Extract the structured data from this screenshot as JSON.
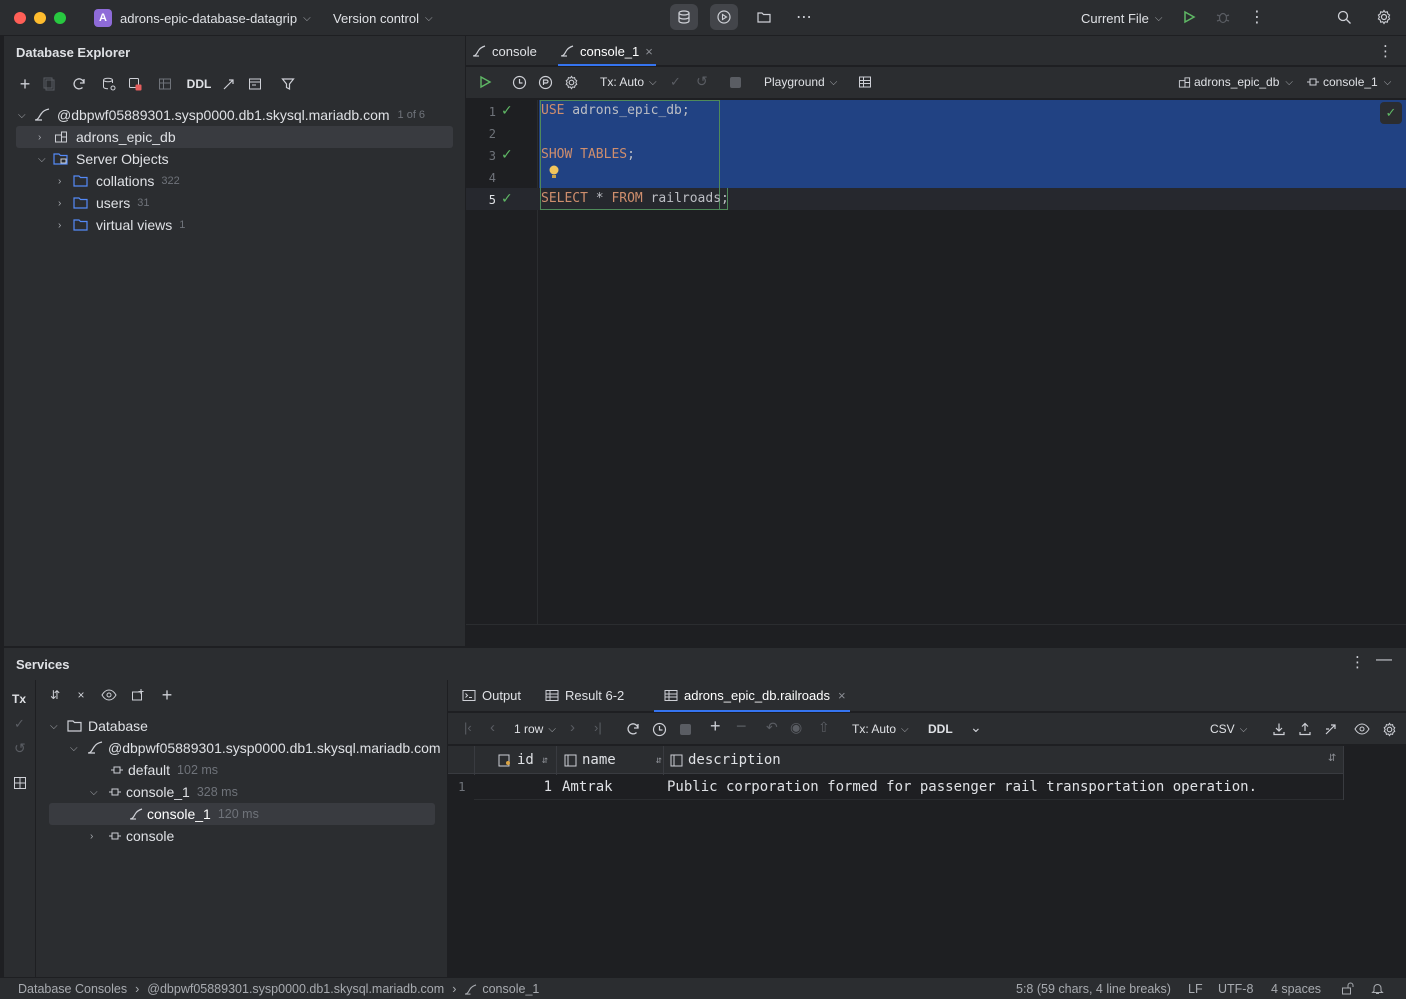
{
  "window": {
    "project_initial": "A",
    "project_name": "adrons-epic-database-datagrip",
    "version_control": "Version control",
    "run_config": "Current File"
  },
  "db_explorer": {
    "title": "Database Explorer",
    "ddl_label": "DDL",
    "tree": {
      "connection": "@dbpwf05889301.sysp0000.db1.skysql.mariadb.com",
      "connection_badge": "1 of 6",
      "schema": "adrons_epic_db",
      "server_objects": "Server Objects",
      "children": [
        {
          "label": "collations",
          "count": "322"
        },
        {
          "label": "users",
          "count": "31"
        },
        {
          "label": "virtual views",
          "count": "1"
        }
      ]
    }
  },
  "editor": {
    "tabs": [
      {
        "label": "console"
      },
      {
        "label": "console_1"
      }
    ],
    "toolbar": {
      "tx_mode": "Tx: Auto",
      "playground": "Playground",
      "schema_selector": "adrons_epic_db",
      "session_selector": "console_1"
    },
    "lines": [
      {
        "num": "1",
        "code": [
          {
            "t": "USE",
            "k": "kw"
          },
          {
            "t": " adrons_epic_db;",
            "k": "id"
          }
        ]
      },
      {
        "num": "2",
        "code": []
      },
      {
        "num": "3",
        "code": [
          {
            "t": "SHOW TABLES",
            "k": "kw"
          },
          {
            "t": ";",
            "k": "id"
          }
        ]
      },
      {
        "num": "4",
        "code": []
      },
      {
        "num": "5",
        "code": [
          {
            "t": "SELECT",
            "k": "kw"
          },
          {
            "t": " * ",
            "k": "id"
          },
          {
            "t": "FROM",
            "k": "kw"
          },
          {
            "t": " railroads;",
            "k": "id"
          }
        ]
      }
    ]
  },
  "services": {
    "title": "Services",
    "tx_label": "Tx",
    "tree": {
      "database": "Database",
      "connection": "@dbpwf05889301.sysp0000.db1.skysql.mariadb.com",
      "default_label": "default",
      "default_time": "102 ms",
      "console1_label": "console_1",
      "console1_time": "328 ms",
      "console1_child_label": "console_1",
      "console1_child_time": "120 ms",
      "console_label": "console"
    },
    "result_tabs": [
      {
        "label": "Output"
      },
      {
        "label": "Result 6-2"
      },
      {
        "label": "adrons_epic_db.railroads"
      }
    ],
    "result_toolbar": {
      "rows": "1 row",
      "tx_mode": "Tx: Auto",
      "ddl": "DDL",
      "export_format": "CSV"
    },
    "grid": {
      "columns": [
        "id",
        "name",
        "description"
      ],
      "rows": [
        {
          "rownum": "1",
          "id": "1",
          "name": "Amtrak",
          "description": "Public corporation formed for passenger rail transportation operation."
        }
      ]
    }
  },
  "statusbar": {
    "crumb1": "Database Consoles",
    "crumb2": "@dbpwf05889301.sysp0000.db1.skysql.mariadb.com",
    "crumb3": "console_1",
    "position": "5:8 (59 chars, 4 line breaks)",
    "line_sep": "LF",
    "encoding": "UTF-8",
    "indent": "4 spaces"
  },
  "colors": {
    "accent": "#3574f0",
    "selection": "#214283",
    "keyword": "#cf8e6d",
    "success": "#5fb865"
  }
}
